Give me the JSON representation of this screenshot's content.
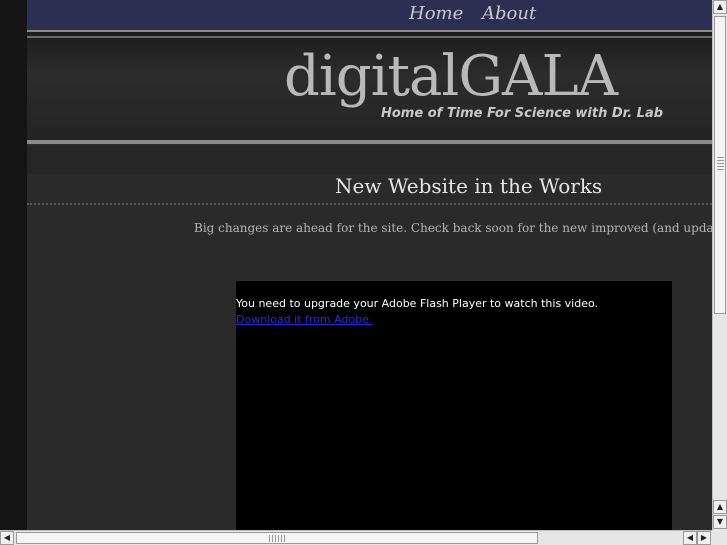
{
  "nav": {
    "items": [
      {
        "label": "Home"
      },
      {
        "label": "About"
      }
    ]
  },
  "header": {
    "brand": "digitalGALA",
    "tagline": "Home of Time For Science with Dr. Lab"
  },
  "main": {
    "heading": "New Website in the Works",
    "body": "Big changes are ahead for the site.  Check back soon for the new improved (and updated often!) site."
  },
  "video": {
    "message": "You need to upgrade your Adobe Flash Player to watch this video.",
    "link_text": "Download it from Adobe."
  },
  "scrollbars": {
    "up_icon": "▲",
    "down_icon": "▼",
    "left_icon": "◀",
    "right_icon": "▶"
  }
}
